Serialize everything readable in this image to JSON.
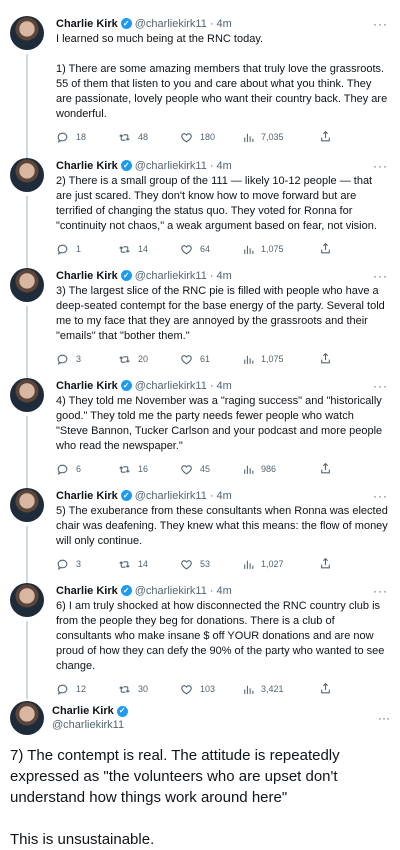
{
  "author": {
    "name": "Charlie Kirk",
    "handle": "@charliekirk11",
    "separator": "·",
    "time": "4m",
    "more": "···"
  },
  "tweets": [
    {
      "text": "I learned so much being at the RNC today.\n\n1) There are some amazing members that truly love the grassroots. 55 of them that listen to you and care about what you think. They are passionate, lovely people who want their country back. They are wonderful.",
      "replies": "18",
      "retweets": "48",
      "likes": "180",
      "views": "7,035"
    },
    {
      "text": "2) There is a small group of the 111 — likely 10-12 people — that are just scared. They don't know how to move forward but are terrified of changing the status quo. They voted for Ronna for \"continuity not chaos,\" a weak argument based on fear, not vision.",
      "replies": "1",
      "retweets": "14",
      "likes": "64",
      "views": "1,075"
    },
    {
      "text": "3) The largest slice of the RNC pie is filled with people who have a deep-seated contempt for the base energy of the party. Several told me to my face that they are annoyed by the grassroots and their \"emails\" that \"bother them.\"",
      "replies": "3",
      "retweets": "20",
      "likes": "61",
      "views": "1,075"
    },
    {
      "text": "4) They told me November was a \"raging success\" and \"historically good.\" They told me the party needs fewer people who watch \"Steve Bannon, Tucker Carlson and your podcast and more people who read the newspaper.\"",
      "replies": "6",
      "retweets": "16",
      "likes": "45",
      "views": "986"
    },
    {
      "text": "5) The exuberance from these consultants when Ronna was elected chair was deafening. They knew what this means: the flow of money will only continue.",
      "replies": "3",
      "retweets": "14",
      "likes": "53",
      "views": "1,027"
    },
    {
      "text": "6) I am truly shocked at how disconnected the RNC country club is from the people they beg for donations. There is a club of consultants who make insane $ off YOUR donations and are now proud of how they can defy the 90% of the party who wanted to see change.",
      "replies": "12",
      "retweets": "30",
      "likes": "103",
      "views": "3,421"
    }
  ],
  "final": {
    "text": "7) The contempt is real. The attitude is repeatedly expressed as \"the volunteers who are upset don't understand how things work around here\"\n\nThis is unsustainable."
  }
}
